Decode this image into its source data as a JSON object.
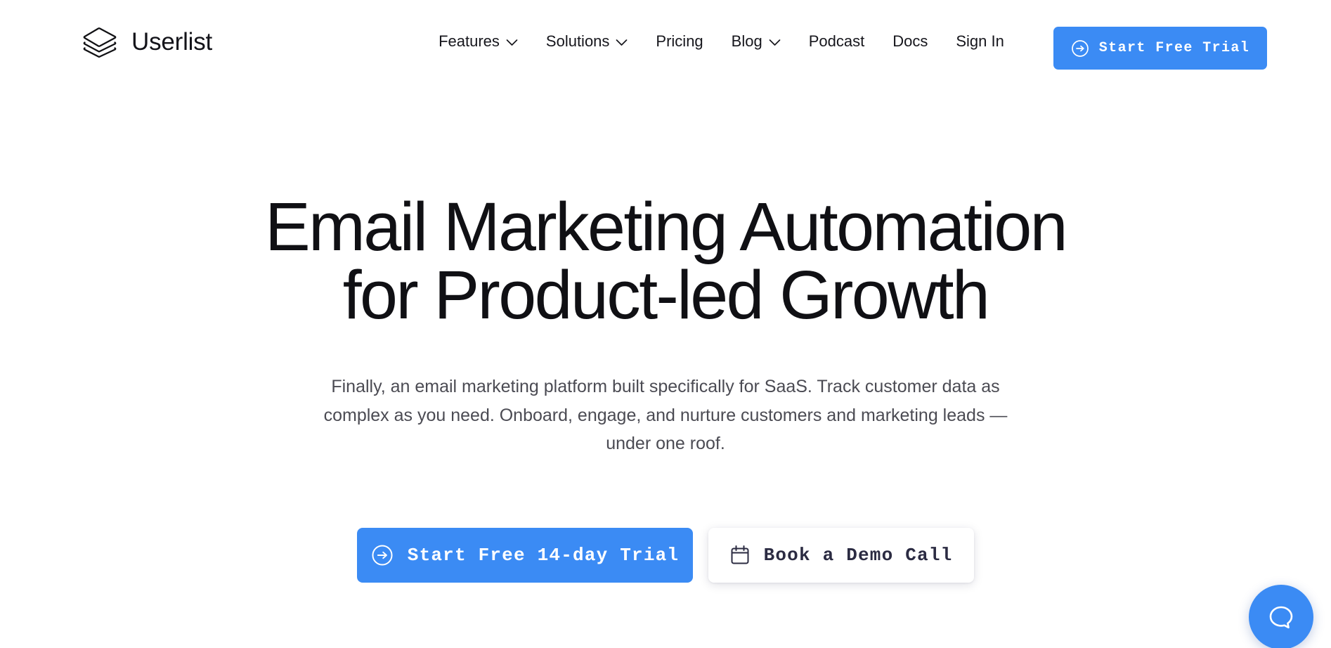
{
  "brand": {
    "name": "Userlist",
    "logo_icon": "layers-stack-icon"
  },
  "nav": {
    "items": [
      {
        "label": "Features",
        "has_dropdown": true,
        "icon": "chevron-down-icon"
      },
      {
        "label": "Solutions",
        "has_dropdown": true,
        "icon": "chevron-down-icon"
      },
      {
        "label": "Pricing",
        "has_dropdown": false,
        "icon": ""
      },
      {
        "label": "Blog",
        "has_dropdown": true,
        "icon": "chevron-down-icon"
      },
      {
        "label": "Podcast",
        "has_dropdown": false,
        "icon": ""
      },
      {
        "label": "Docs",
        "has_dropdown": false,
        "icon": ""
      },
      {
        "label": "Sign In",
        "has_dropdown": false,
        "icon": ""
      }
    ],
    "cta": {
      "label": "Start Free Trial",
      "icon": "arrow-right-circle-icon"
    }
  },
  "hero": {
    "title_line1": "Email Marketing Automation",
    "title_line2": "for Product-led Growth",
    "subtitle": "Finally, an email marketing platform built specifically for SaaS. Track customer data as complex as you need. Onboard, engage, and nurture customers and marketing leads — under one roof.",
    "primary_cta": {
      "label": "Start Free 14-day Trial",
      "icon": "arrow-right-circle-icon"
    },
    "secondary_cta": {
      "label": "Book a Demo Call",
      "icon": "calendar-icon"
    }
  },
  "chat": {
    "icon": "chat-bubble-icon",
    "aria_label": "Open chat"
  },
  "colors": {
    "accent_blue": "#3b8bf4",
    "text_dark": "#101014",
    "text_muted": "#4b4b53",
    "secondary_btn_text": "#2b2b42",
    "page_background": "#ffffff"
  }
}
